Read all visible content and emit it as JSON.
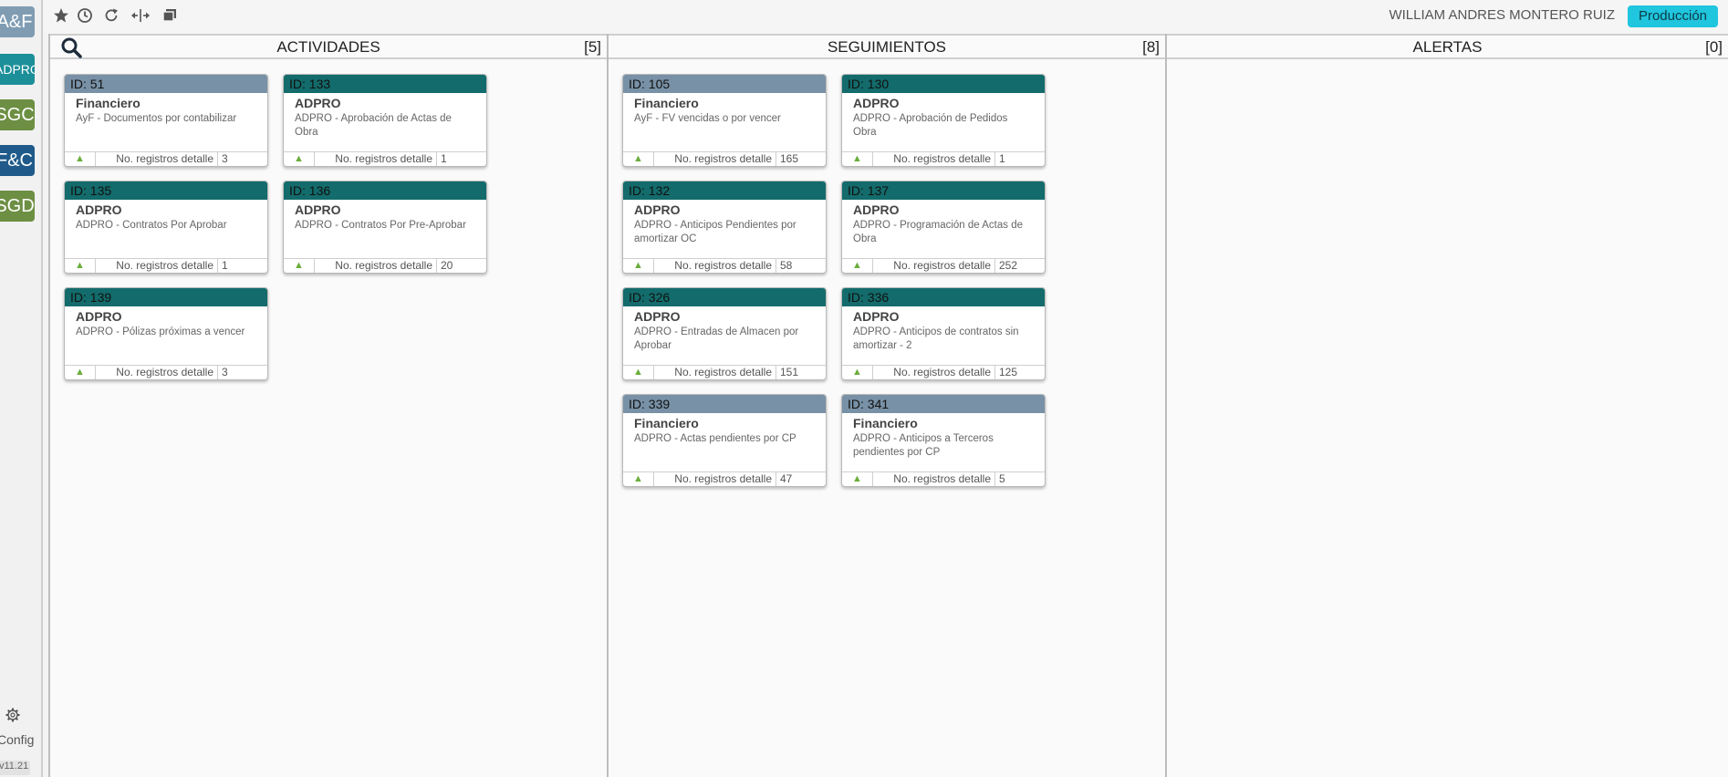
{
  "sidebar": {
    "apps": [
      {
        "label": "A&F",
        "color": "#7f9cb3"
      },
      {
        "label": "ADPRO",
        "color": "#1c8f99"
      },
      {
        "label": "SGC",
        "color": "#6d8f43"
      },
      {
        "label": "F&C",
        "color": "#1f5a8a"
      },
      {
        "label": "SGD",
        "color": "#6d8f43"
      }
    ],
    "config_label": "Config",
    "version": "v11.21"
  },
  "topbar": {
    "user_name": "WILLIAM ANDRES MONTERO RUIZ",
    "environment": "Producción"
  },
  "footer_label": "No. registros detalle",
  "colors": {
    "financiero": "#7891a6",
    "adpro": "#136b6b",
    "environment": "#20c5de",
    "arrow": "#6aad3a"
  },
  "columns": [
    {
      "title": "ACTIVIDADES",
      "count": "[5]",
      "cards": [
        {
          "id": "ID: 51",
          "type": "financiero",
          "category": "Financiero",
          "description": "AyF - Documentos por contabilizar",
          "count": "3"
        },
        {
          "id": "ID: 133",
          "type": "adpro",
          "category": "ADPRO",
          "description": "ADPRO - Aprobación de Actas de Obra",
          "count": "1"
        },
        {
          "id": "ID: 135",
          "type": "adpro",
          "category": "ADPRO",
          "description": "ADPRO - Contratos Por Aprobar",
          "count": "1"
        },
        {
          "id": "ID: 136",
          "type": "adpro",
          "category": "ADPRO",
          "description": "ADPRO - Contratos Por Pre-Aprobar",
          "count": "20"
        },
        {
          "id": "ID: 139",
          "type": "adpro",
          "category": "ADPRO",
          "description": "ADPRO - Pólizas próximas a vencer",
          "count": "3"
        }
      ]
    },
    {
      "title": "SEGUIMIENTOS",
      "count": "[8]",
      "cards": [
        {
          "id": "ID: 105",
          "type": "financiero",
          "category": "Financiero",
          "description": "AyF - FV vencidas o por vencer",
          "count": "165"
        },
        {
          "id": "ID: 130",
          "type": "adpro",
          "category": "ADPRO",
          "description": "ADPRO - Aprobación de Pedidos Obra",
          "count": "1"
        },
        {
          "id": "ID: 132",
          "type": "adpro",
          "category": "ADPRO",
          "description": "ADPRO - Anticipos Pendientes por amortizar OC",
          "count": "58"
        },
        {
          "id": "ID: 137",
          "type": "adpro",
          "category": "ADPRO",
          "description": "ADPRO - Programación de Actas de Obra",
          "count": "252"
        },
        {
          "id": "ID: 326",
          "type": "adpro",
          "category": "ADPRO",
          "description": "ADPRO - Entradas de Almacen por Aprobar",
          "count": "151"
        },
        {
          "id": "ID: 336",
          "type": "adpro",
          "category": "ADPRO",
          "description": "ADPRO - Anticipos de contratos sin amortizar - 2",
          "count": "125"
        },
        {
          "id": "ID: 339",
          "type": "financiero",
          "category": "Financiero",
          "description": "ADPRO - Actas pendientes por CP",
          "count": "47"
        },
        {
          "id": "ID: 341",
          "type": "financiero",
          "category": "Financiero",
          "description": "ADPRO - Anticipos a Terceros pendientes por CP",
          "count": "5"
        }
      ]
    },
    {
      "title": "ALERTAS",
      "count": "[0]",
      "cards": []
    }
  ]
}
